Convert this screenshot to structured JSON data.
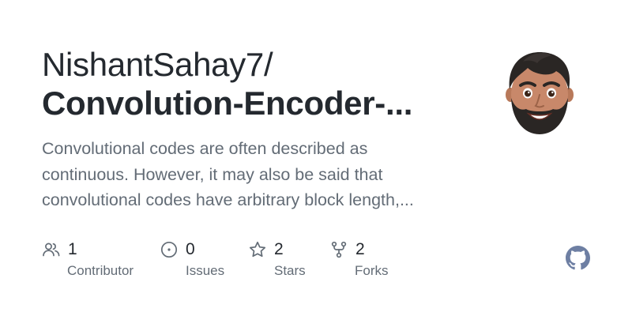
{
  "repo": {
    "owner": "NishantSahay7/",
    "name": "Convolution-Encoder-...",
    "description_lines": [
      "Convolutional codes are often described as",
      "continuous. However, it may also be said that",
      "convolutional codes have arbitrary block length,..."
    ]
  },
  "stats": [
    {
      "icon": "people-icon",
      "value": "1",
      "label": "Contributor"
    },
    {
      "icon": "issue-opened-icon",
      "value": "0",
      "label": "Issues"
    },
    {
      "icon": "star-icon",
      "value": "2",
      "label": "Stars"
    },
    {
      "icon": "repo-forked-icon",
      "value": "2",
      "label": "Forks"
    }
  ],
  "avatar": {
    "icon": "memoji-avatar"
  },
  "logo": {
    "icon": "github-mark-icon"
  },
  "colors": {
    "text": "#24292f",
    "muted": "#636c76",
    "icon": "#636c76",
    "logo": "#6e7fa3"
  }
}
